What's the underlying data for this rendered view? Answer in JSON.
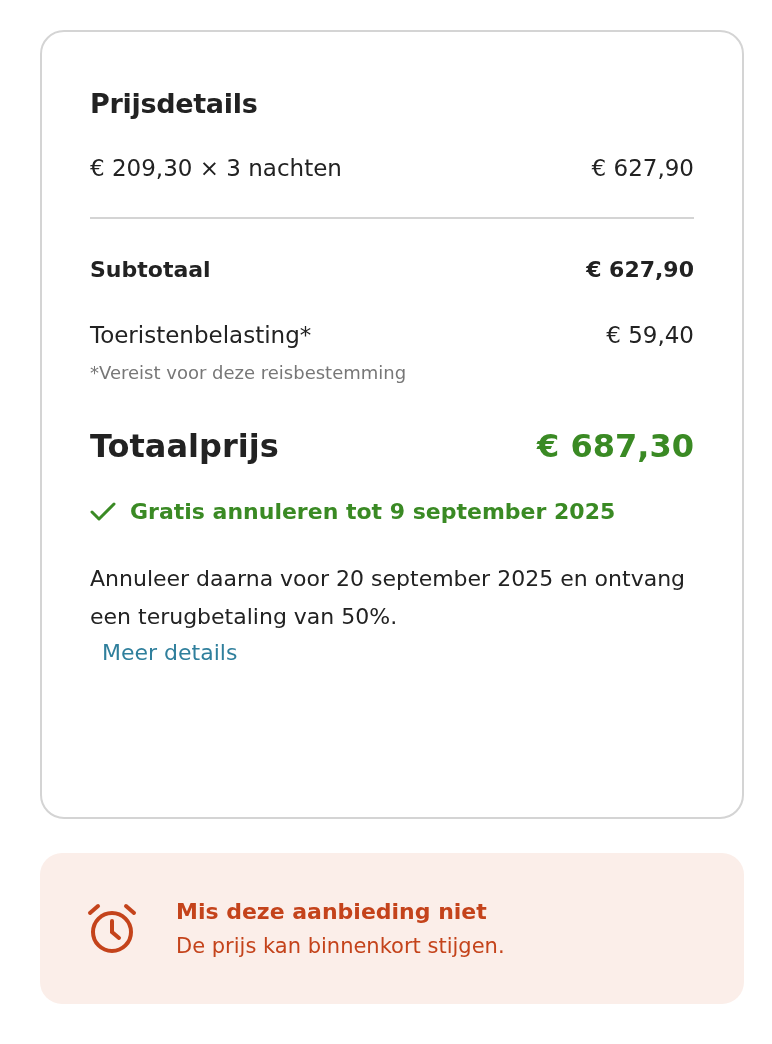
{
  "price_details": {
    "title": "Prijsdetails",
    "nightly_line": {
      "label": "€ 209,30 × 3 nachten",
      "amount": "€ 627,90"
    },
    "subtotal": {
      "label": "Subtotaal",
      "amount": "€ 627,90"
    },
    "tax": {
      "label": "Toeristenbelasting*",
      "amount": "€ 59,40",
      "note": "*Vereist voor deze reisbestemming"
    },
    "total": {
      "label": "Totaalprijs",
      "amount": "€ 687,30"
    },
    "free_cancellation": "Gratis annuleren tot 9 september 2025",
    "policy_text": "Annuleer daarna voor 20 september 2025 en ontvang een terugbetaling van 50%.",
    "more_link": "Meer details"
  },
  "alert": {
    "title": "Mis deze aanbieding niet",
    "message": "De prijs kan binnenkort stijgen."
  }
}
